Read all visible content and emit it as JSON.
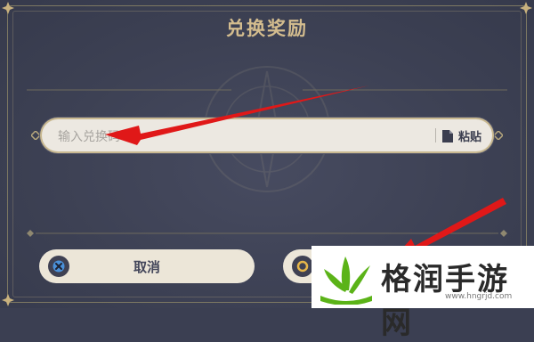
{
  "dialog": {
    "title": "兑换奖励",
    "input_placeholder": "输入兑换码",
    "paste_label": "粘贴",
    "cancel_label": "取消"
  },
  "watermark": {
    "site_name": "格润手游网",
    "site_url": "www.hngrjd.com"
  },
  "colors": {
    "panel_bg": "#3d4154",
    "title_gold": "#d3bc8e",
    "button_bg": "#ece6d8",
    "annotation_arrow": "#e01818",
    "logo_green": "#5bb318"
  }
}
